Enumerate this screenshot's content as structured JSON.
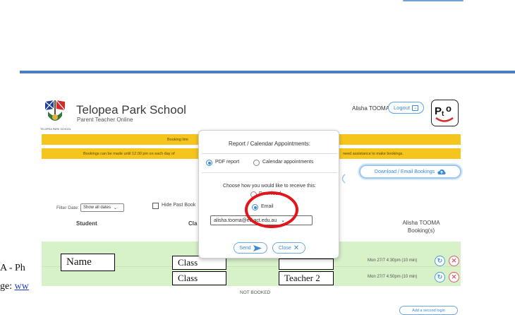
{
  "document": {
    "text_line_1": "A - Ph",
    "text_line_2_prefix": "ge: ",
    "text_line_2_link": "ww"
  },
  "school": {
    "logo_caption": "TELOPEA PARK SCHOOL",
    "name": "Telopea Park School",
    "subtitle": "Parent Teacher Online"
  },
  "header": {
    "user_name": "Alisha TOOMA",
    "logout_label": "Logout",
    "app_logo_text": "Pto"
  },
  "banners": {
    "booking_text": "Booking limi",
    "bookings_left": "Bookings can be made until 12.00 pm on each day of",
    "bookings_right": "need assistance to make bookings."
  },
  "toolbar": {
    "download_label": "Download / Email Bookings"
  },
  "filters": {
    "date_label": "Filter Date:",
    "date_value": "Show all dates",
    "hide_past_label": "Hide Past Book"
  },
  "table": {
    "col_student": "Student",
    "col_class": "Cla",
    "col_teacher_name": "Alisha TOOMA",
    "col_teacher_bookings": "Booking(s)",
    "name_label": "Name",
    "class_1": "Class",
    "class_2": "Class",
    "teacher_2": "Teacher 2",
    "slots": [
      {
        "time": "Mon 27/7 4:30pm (10 min)"
      },
      {
        "time": "Mon 27/7 4:50pm (10 min)"
      }
    ],
    "not_booked": "NOT BOOKED",
    "add_login_label": "Add a second login"
  },
  "modal": {
    "title": "Report / Calendar Appointments:",
    "pdf_label": "PDF report",
    "calendar_label": "Calendar appointments",
    "how_label": "Choose how you would like to receive this:",
    "download_label": "Download",
    "email_label": "Email",
    "email_value": "alisha.tooma@ed.act.edu.au",
    "send_label": "Send",
    "close_label": "Close",
    "selected_report": "pdf",
    "selected_delivery": "email"
  },
  "colors": {
    "accent_blue": "#3a8ad6",
    "banner_yellow": "#f6c51d",
    "row_green": "#d7f1c9",
    "annotation_red": "#e4141b"
  }
}
